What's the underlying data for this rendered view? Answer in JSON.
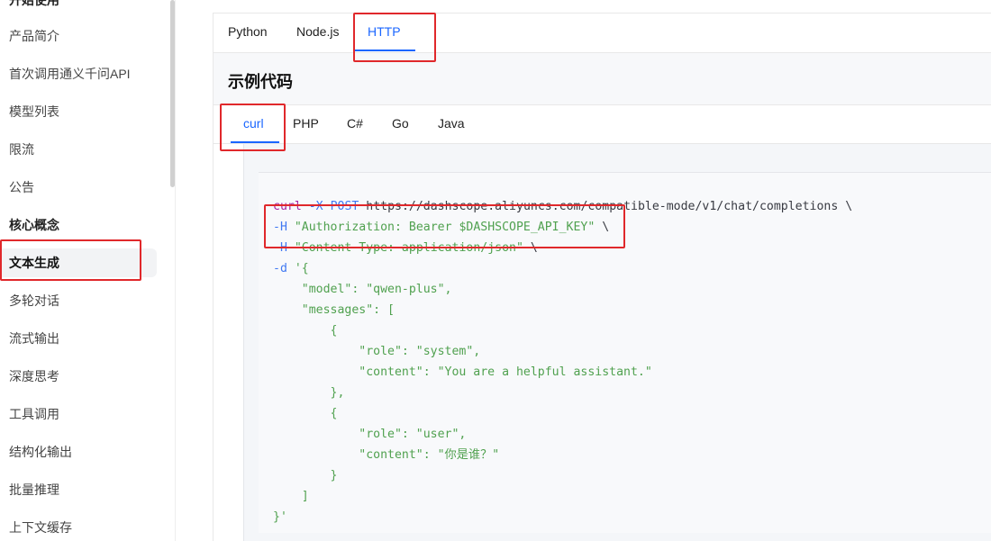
{
  "sidebar": {
    "group_partial": "开始使用",
    "items_top": [
      "产品简介",
      "首次调用通义千问API",
      "模型列表",
      "限流",
      "公告"
    ],
    "group_core": "核心概念",
    "items_core": [
      "文本生成",
      "多轮对话",
      "流式输出",
      "深度思考",
      "工具调用",
      "结构化输出",
      "批量推理",
      "上下文缓存"
    ],
    "active_item": "文本生成"
  },
  "lang_tabs": [
    "Python",
    "Node.js",
    "HTTP"
  ],
  "active_lang_tab": "HTTP",
  "section_title": "示例代码",
  "code_tabs": [
    "curl",
    "PHP",
    "C#",
    "Go",
    "Java"
  ],
  "active_code_tab": "curl",
  "code": {
    "l1_cmd": "curl",
    "l1_flag": "-X",
    "l1_method": "POST",
    "l1_rest": " https://dashscope.aliyuncs.com/compatible-mode/v1/chat/completions \\",
    "l2_flag": "-H",
    "l2_str": "\"Authorization: Bearer $DASHSCOPE_API_KEY\"",
    "l2_tail": " \\",
    "l3_flag": "-H",
    "l3_str": "\"Content-Type: application/json\"",
    "l3_tail": " \\",
    "l4_flag": "-d",
    "l4_str": "'{",
    "l5": "    \"model\": \"qwen-plus\",",
    "l6": "    \"messages\": [",
    "l7": "        {",
    "l8": "            \"role\": \"system\",",
    "l9": "            \"content\": \"You are a helpful assistant.\"",
    "l10": "        },",
    "l11": "        {",
    "l12": "            \"role\": \"user\",",
    "l13": "            \"content\": \"你是谁？\"",
    "l14": "        }",
    "l15": "    ]",
    "l16": "}'"
  },
  "colors": {
    "accent": "#1a66ff",
    "highlight_box": "#e0282b"
  }
}
